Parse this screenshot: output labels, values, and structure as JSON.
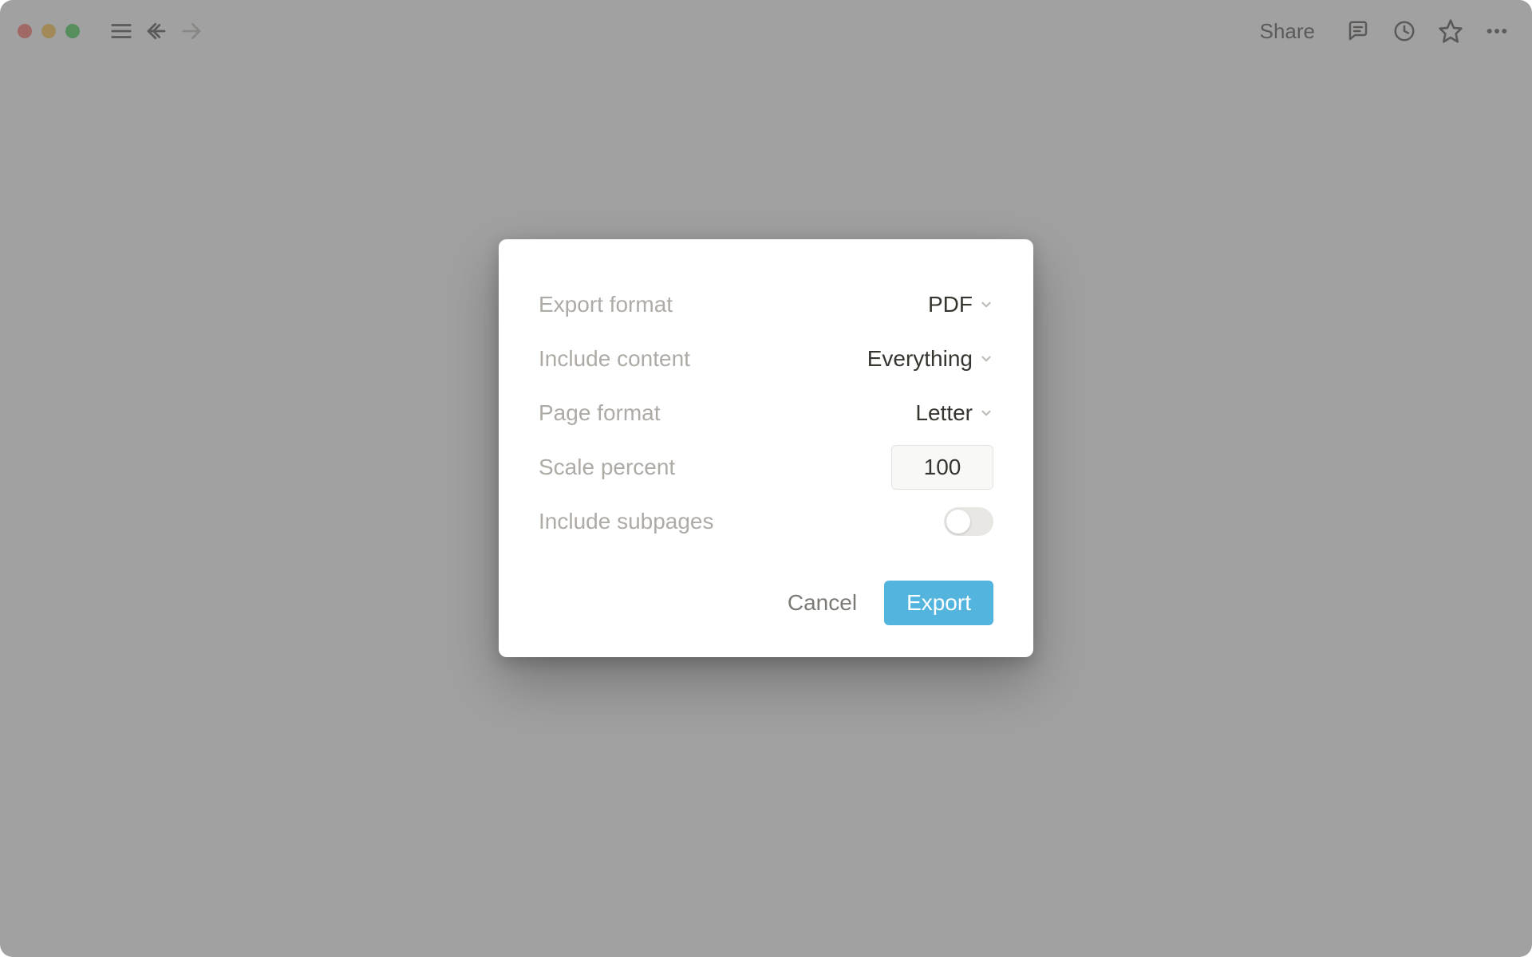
{
  "toolbar": {
    "share_label": "Share"
  },
  "modal": {
    "export_format": {
      "label": "Export format",
      "value": "PDF"
    },
    "include_content": {
      "label": "Include content",
      "value": "Everything"
    },
    "page_format": {
      "label": "Page format",
      "value": "Letter"
    },
    "scale_percent": {
      "label": "Scale percent",
      "value": "100"
    },
    "include_subpages": {
      "label": "Include subpages",
      "value": false
    },
    "cancel_label": "Cancel",
    "export_label": "Export"
  }
}
